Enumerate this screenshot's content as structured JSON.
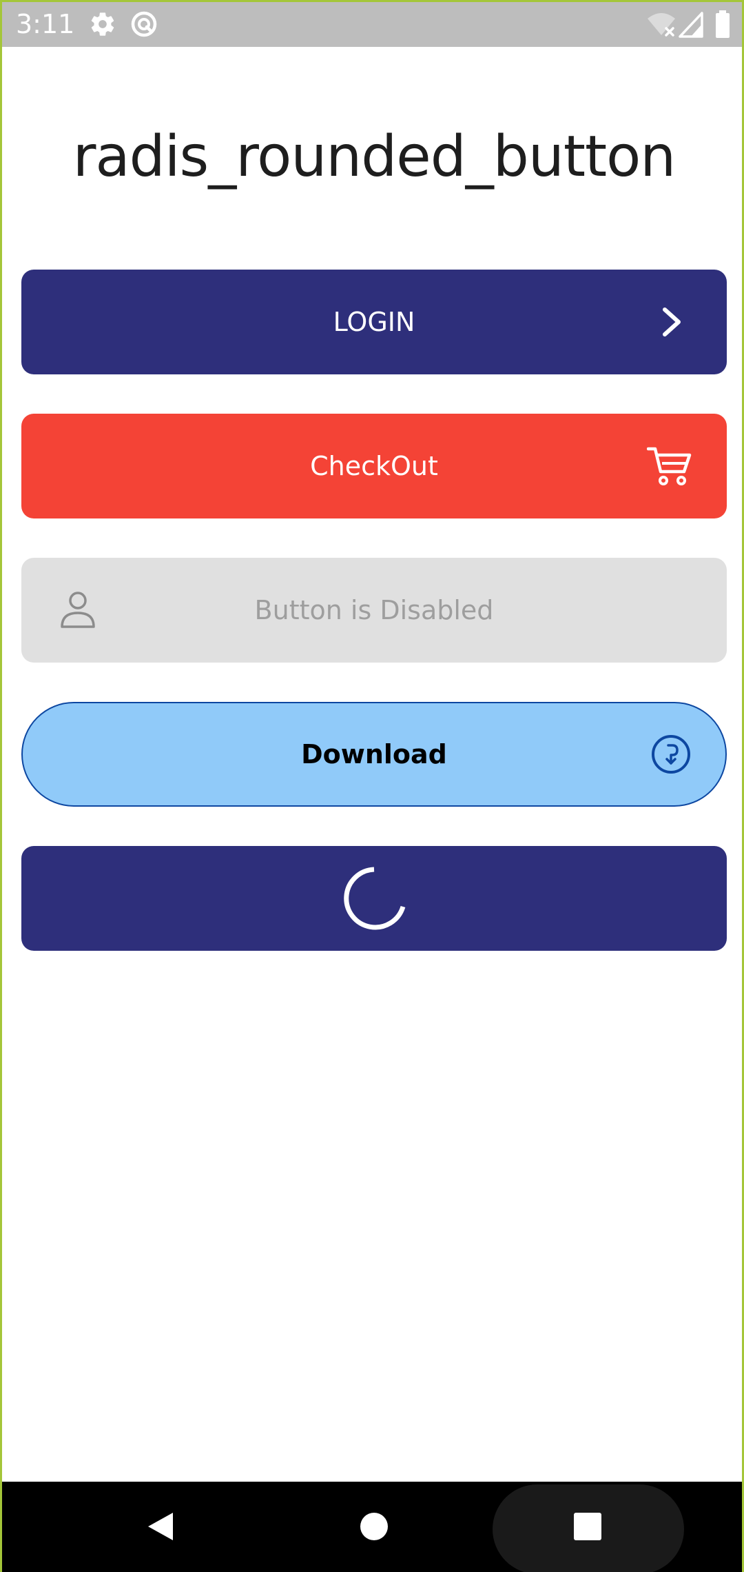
{
  "status_bar": {
    "time": "3:11",
    "icons": [
      "settings-gear-icon",
      "do-not-disturb-icon",
      "wifi-off-icon",
      "cell-signal-icon",
      "battery-icon"
    ]
  },
  "page": {
    "title": "radis_rounded_button"
  },
  "buttons": {
    "login": {
      "label": "LOGIN",
      "icon": "chevron-right-icon",
      "color": "#2e2f7b"
    },
    "checkout": {
      "label": "CheckOut",
      "icon": "shopping-cart-icon",
      "color": "#f44336"
    },
    "disabled": {
      "label": "Button is Disabled",
      "icon": "person-icon",
      "color": "#e0e0e0"
    },
    "download": {
      "label": "Download",
      "icon": "download-circle-icon",
      "color": "#90caf9",
      "border_color": "#0d47a1"
    },
    "loading": {
      "icon": "loading-spinner-icon",
      "color": "#2e2f7b"
    }
  },
  "nav_bar": {
    "icons": [
      "back-icon",
      "home-icon",
      "recents-icon"
    ]
  }
}
